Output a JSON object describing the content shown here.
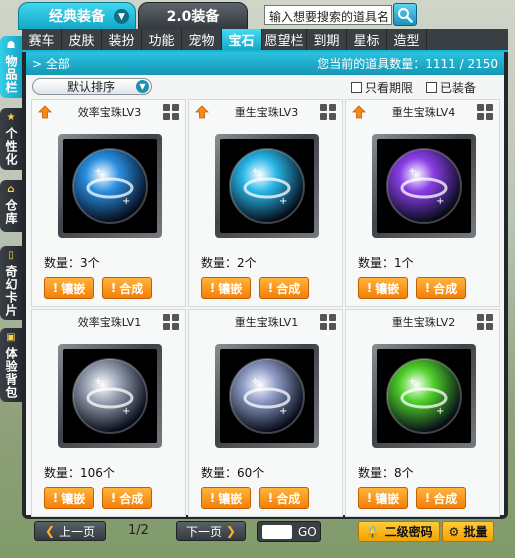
{
  "mode_tabs": {
    "classic": "经典装备",
    "v20": "2.0装备"
  },
  "search": {
    "value": "输入想要搜索的道具名"
  },
  "side_tabs": [
    {
      "label": "物品栏"
    },
    {
      "label": "个性化"
    },
    {
      "label": "仓库"
    },
    {
      "label": "奇幻卡片"
    },
    {
      "label": "体验背包"
    }
  ],
  "categories": [
    "赛车",
    "皮肤",
    "装扮",
    "功能",
    "宠物",
    "宝石",
    "愿望栏",
    "到期",
    "星标",
    "造型"
  ],
  "active_category": "宝石",
  "sub_bar": {
    "all_label": "全部",
    "count_label": "您当前的道具数量：1111 / 2150"
  },
  "toolbar": {
    "sort_label": "默认排序",
    "only_expiring": "只看期限",
    "equipped": "已装备"
  },
  "items": [
    {
      "name": "效率宝珠LV3",
      "qty": "数量：3个",
      "color": "#2a8fe0",
      "upgrade": true
    },
    {
      "name": "重生宝珠LV3",
      "qty": "数量：2个",
      "color": "#29b7e8",
      "upgrade": true
    },
    {
      "name": "重生宝珠LV4",
      "qty": "数量：1个",
      "color": "#8a3fe6",
      "upgrade": true
    },
    {
      "name": "效率宝珠LV1",
      "qty": "数量：106个",
      "color": "#9aa4b6",
      "upgrade": false
    },
    {
      "name": "重生宝珠LV1",
      "qty": "数量：60个",
      "color": "#8e9cc6",
      "upgrade": false
    },
    {
      "name": "重生宝珠LV2",
      "qty": "数量：8个",
      "color": "#4fd12a",
      "upgrade": false
    }
  ],
  "card_buttons": {
    "inlay": "镶嵌",
    "combine": "合成"
  },
  "footer": {
    "prev": "上一页",
    "page": "1/2",
    "next": "下一页",
    "go": "GO",
    "password": "二级密码",
    "batch": "批量"
  }
}
